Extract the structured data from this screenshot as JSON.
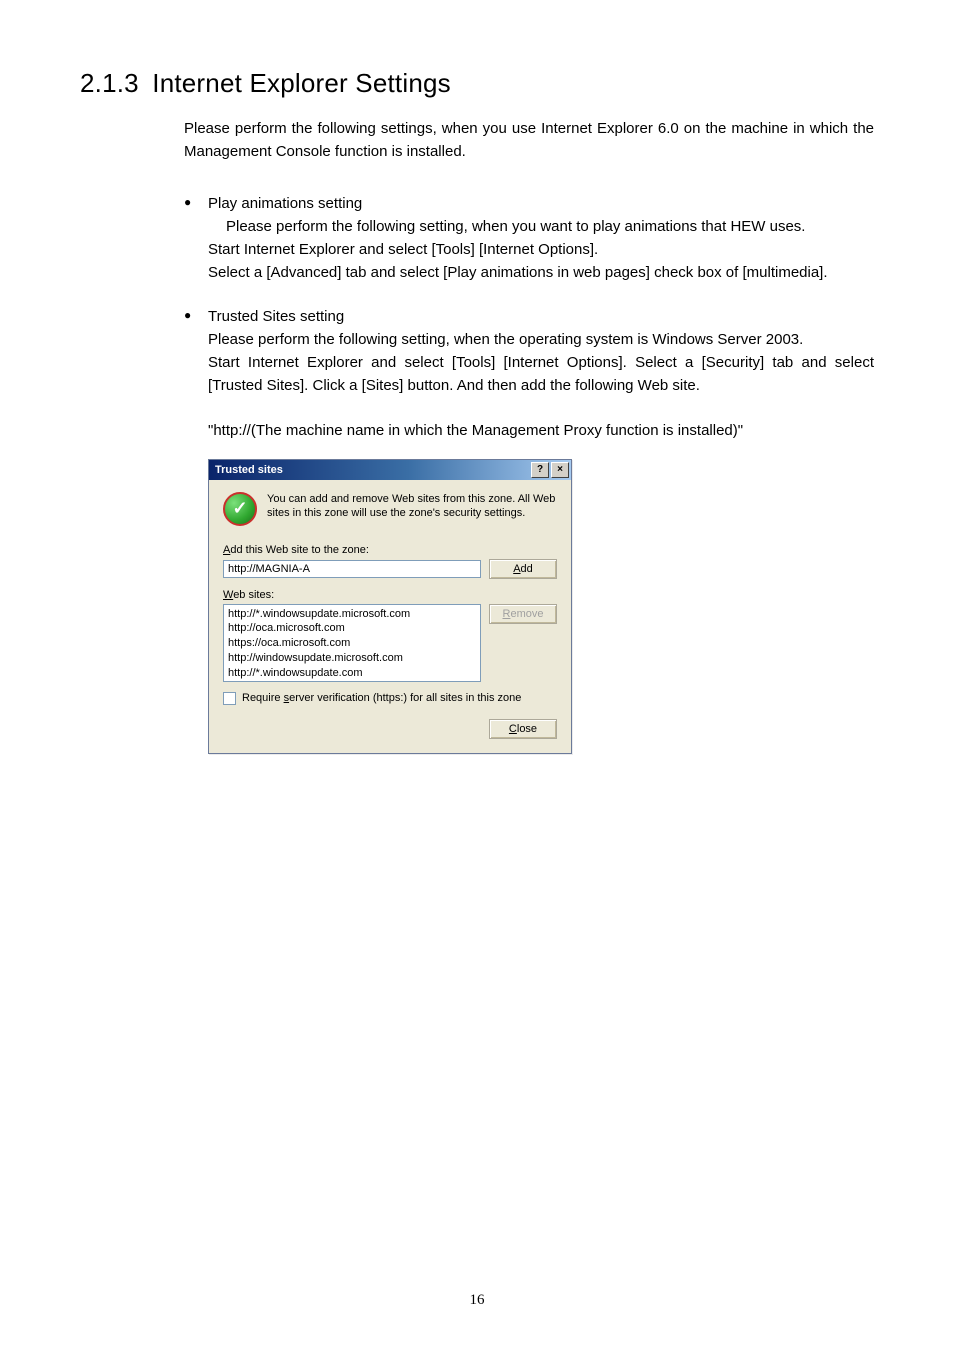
{
  "heading": {
    "number": "2.1.3",
    "title": "Internet Explorer Settings"
  },
  "intro": "Please perform the following settings, when you use Internet Explorer 6.0 on the machine in which the Management Console function is installed.",
  "items": [
    {
      "title": "Play animations setting",
      "lines": [
        "Please perform the following setting, when you want to play animations that HEW uses.",
        "Start Internet Explorer and select [Tools] [Internet Options].",
        "Select a [Advanced] tab and select [Play animations in web pages] check box of [multimedia]."
      ]
    },
    {
      "title": "Trusted Sites setting",
      "lines": [
        "Please perform the following setting, when the operating system is Windows Server 2003.",
        "Start Internet Explorer and select [Tools] [Internet Options]. Select a [Security] tab and select [Trusted Sites]. Click a [Sites] button. And then add the following Web site."
      ]
    }
  ],
  "final_url": "\"http://(The machine name in which the Management Proxy function is installed)\"",
  "dialog": {
    "title": "Trusted sites",
    "help_glyph": "?",
    "close_glyph": "×",
    "desc": "You can add and remove Web sites from this zone. All Web sites in this zone will use the zone's security settings.",
    "add_label": "Add this Web site to the zone:",
    "add_value": "http://MAGNIA-A",
    "add_btn": "Add",
    "websites_label": "Web sites:",
    "sites": [
      "http://*.windowsupdate.microsoft.com",
      "http://oca.microsoft.com",
      "https://oca.microsoft.com",
      "http://windowsupdate.microsoft.com",
      "http://*.windowsupdate.com"
    ],
    "remove_btn": "Remove",
    "require_label": "Require server verification (https:) for all sites in this zone",
    "close_btn": "Close"
  },
  "page_number": "16"
}
